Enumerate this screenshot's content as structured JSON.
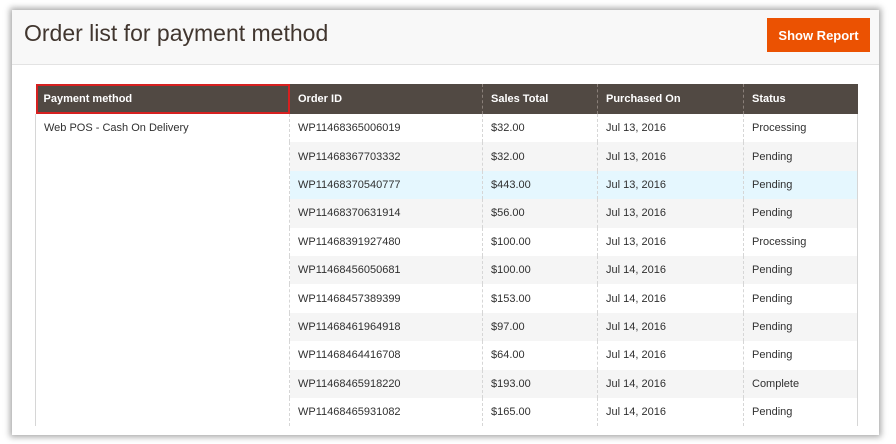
{
  "header": {
    "title": "Order list for payment method",
    "show_report_label": "Show Report"
  },
  "table": {
    "columns": [
      "Payment method",
      "Order ID",
      "Sales Total",
      "Purchased On",
      "Status"
    ],
    "payment_method": "Web POS - Cash On Delivery",
    "rows": [
      {
        "order_id": "WP11468365006019",
        "sales_total": "$32.00",
        "purchased_on": "Jul 13, 2016",
        "status": "Processing"
      },
      {
        "order_id": "WP11468367703332",
        "sales_total": "$32.00",
        "purchased_on": "Jul 13, 2016",
        "status": "Pending"
      },
      {
        "order_id": "WP11468370540777",
        "sales_total": "$443.00",
        "purchased_on": "Jul 13, 2016",
        "status": "Pending"
      },
      {
        "order_id": "WP11468370631914",
        "sales_total": "$56.00",
        "purchased_on": "Jul 13, 2016",
        "status": "Pending"
      },
      {
        "order_id": "WP11468391927480",
        "sales_total": "$100.00",
        "purchased_on": "Jul 13, 2016",
        "status": "Processing"
      },
      {
        "order_id": "WP11468456050681",
        "sales_total": "$100.00",
        "purchased_on": "Jul 14, 2016",
        "status": "Pending"
      },
      {
        "order_id": "WP11468457389399",
        "sales_total": "$153.00",
        "purchased_on": "Jul 14, 2016",
        "status": "Pending"
      },
      {
        "order_id": "WP11468461964918",
        "sales_total": "$97.00",
        "purchased_on": "Jul 14, 2016",
        "status": "Pending"
      },
      {
        "order_id": "WP11468464416708",
        "sales_total": "$64.00",
        "purchased_on": "Jul 14, 2016",
        "status": "Pending"
      },
      {
        "order_id": "WP11468465918220",
        "sales_total": "$193.00",
        "purchased_on": "Jul 14, 2016",
        "status": "Complete"
      },
      {
        "order_id": "WP11468465931082",
        "sales_total": "$165.00",
        "purchased_on": "Jul 14, 2016",
        "status": "Pending"
      }
    ]
  },
  "colors": {
    "accent": "#eb5202",
    "header_bg": "#514943",
    "highlight_row": "#e5f7fe",
    "selected_outline": "#d62020"
  }
}
